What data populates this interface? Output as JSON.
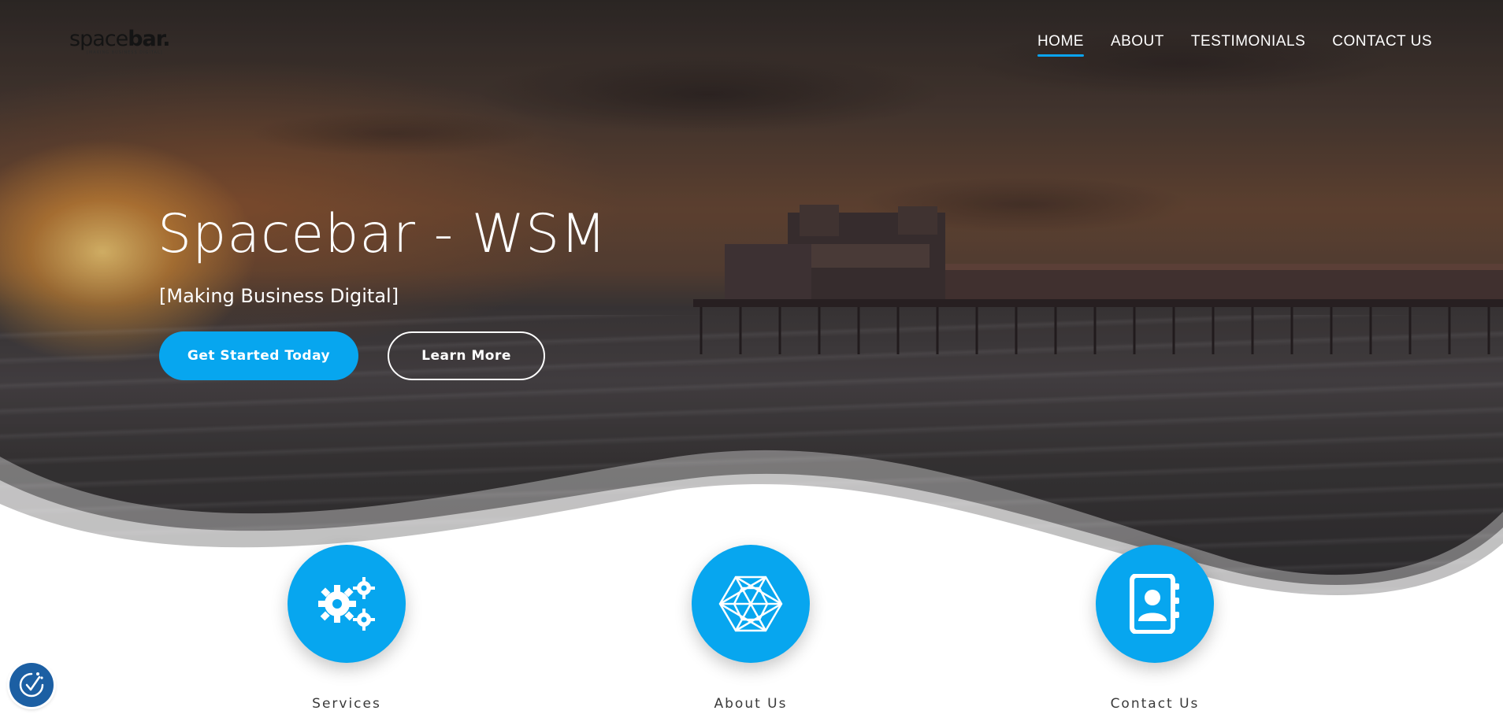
{
  "brand": {
    "logo_light": "space",
    "logo_bold": "bar.",
    "logo_tagline": "[MAKING BUSINESS DIGITAL]"
  },
  "nav": {
    "items": [
      "HOME",
      "ABOUT",
      "TESTIMONIALS",
      "CONTACT US"
    ],
    "active": "HOME"
  },
  "hero": {
    "title": "Spacebar - WSM",
    "subtitle": "[Making Business Digital]",
    "primary_button": "Get Started Today",
    "secondary_button": "Learn More"
  },
  "features": [
    {
      "label": "Services",
      "icon": "gears-icon"
    },
    {
      "label": "About Us",
      "icon": "network-hexagon-icon"
    },
    {
      "label": "Contact Us",
      "icon": "contact-book-icon"
    }
  ],
  "colors": {
    "accent": "#07a6ef",
    "accessibility_button": "#1c5fa3",
    "text_dark": "#3a3a3a"
  },
  "accessibility": {
    "icon": "accessibility-icon"
  }
}
